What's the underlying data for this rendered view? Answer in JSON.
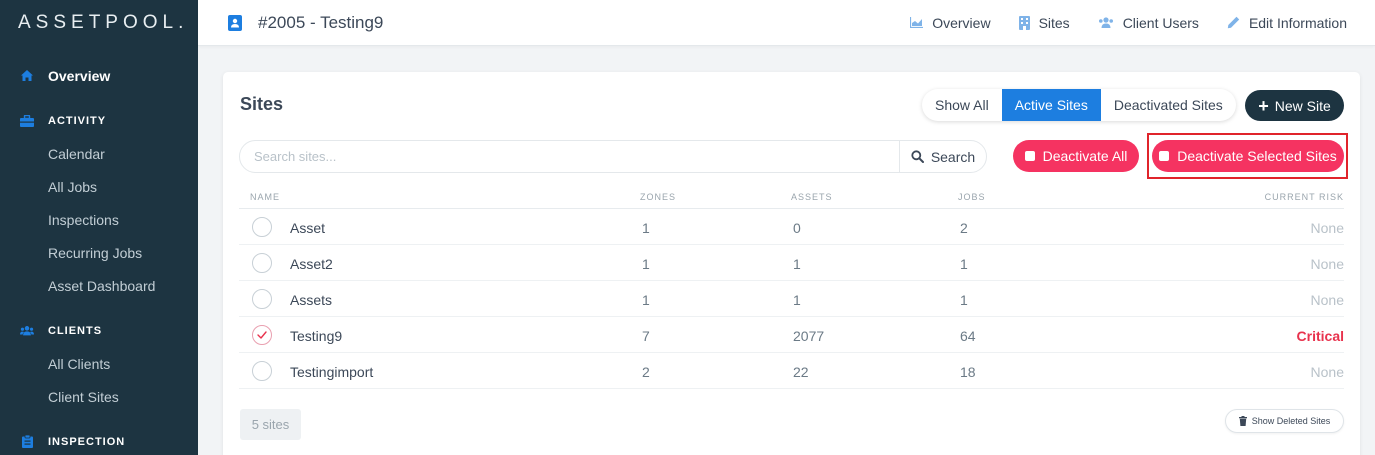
{
  "app": {
    "logo": "ASSETPOOL."
  },
  "sidebar": {
    "overview": "Overview",
    "activity": {
      "title": "ACTIVITY",
      "items": [
        "Calendar",
        "All Jobs",
        "Inspections",
        "Recurring Jobs",
        "Asset Dashboard"
      ]
    },
    "clients": {
      "title": "CLIENTS",
      "items": [
        "All Clients",
        "Client Sites"
      ]
    },
    "inspection": {
      "title": "INSPECTION"
    }
  },
  "header": {
    "title": "#2005 - Testing9",
    "nav": {
      "overview": "Overview",
      "sites": "Sites",
      "client_users": "Client Users",
      "edit_information": "Edit Information"
    }
  },
  "card": {
    "title": "Sites",
    "filters": {
      "show_all": "Show All",
      "active_sites": "Active Sites",
      "deactivated_sites": "Deactivated Sites",
      "selected": "Active Sites"
    },
    "new_site": "New Site",
    "search": {
      "placeholder": "Search sites...",
      "value": "",
      "button": "Search"
    },
    "deactivate_all": "Deactivate All",
    "deactivate_selected": "Deactivate Selected Sites",
    "columns": {
      "name": "NAME",
      "zones": "ZONES",
      "assets": "ASSETS",
      "jobs": "JOBS",
      "risk": "CURRENT RISK"
    },
    "rows": [
      {
        "name": "Asset",
        "zones": "1",
        "assets": "0",
        "jobs": "2",
        "risk": "None",
        "selected": false
      },
      {
        "name": "Asset2",
        "zones": "1",
        "assets": "1",
        "jobs": "1",
        "risk": "None",
        "selected": false
      },
      {
        "name": "Assets",
        "zones": "1",
        "assets": "1",
        "jobs": "1",
        "risk": "None",
        "selected": false
      },
      {
        "name": "Testing9",
        "zones": "7",
        "assets": "2077",
        "jobs": "64",
        "risk": "Critical",
        "selected": true
      },
      {
        "name": "Testingimport",
        "zones": "2",
        "assets": "22",
        "jobs": "18",
        "risk": "None",
        "selected": false
      }
    ],
    "site_count": "5 sites",
    "show_deleted": "Show Deleted Sites"
  },
  "colors": {
    "sidebar_bg": "#1d3441",
    "accent_blue": "#1d7ee0",
    "danger_red": "#f53361",
    "critical_text": "#e8324d"
  },
  "icons": {
    "overview": "home-icon",
    "activity": "briefcase-icon",
    "clients": "users-icon",
    "inspection": "clipboard-icon",
    "title": "contact-book-icon",
    "nav_overview": "chart-icon",
    "nav_sites": "building-icon",
    "nav_client_users": "users-icon",
    "nav_edit": "pencil-icon",
    "search": "search-icon",
    "show_deleted": "trash-icon"
  }
}
